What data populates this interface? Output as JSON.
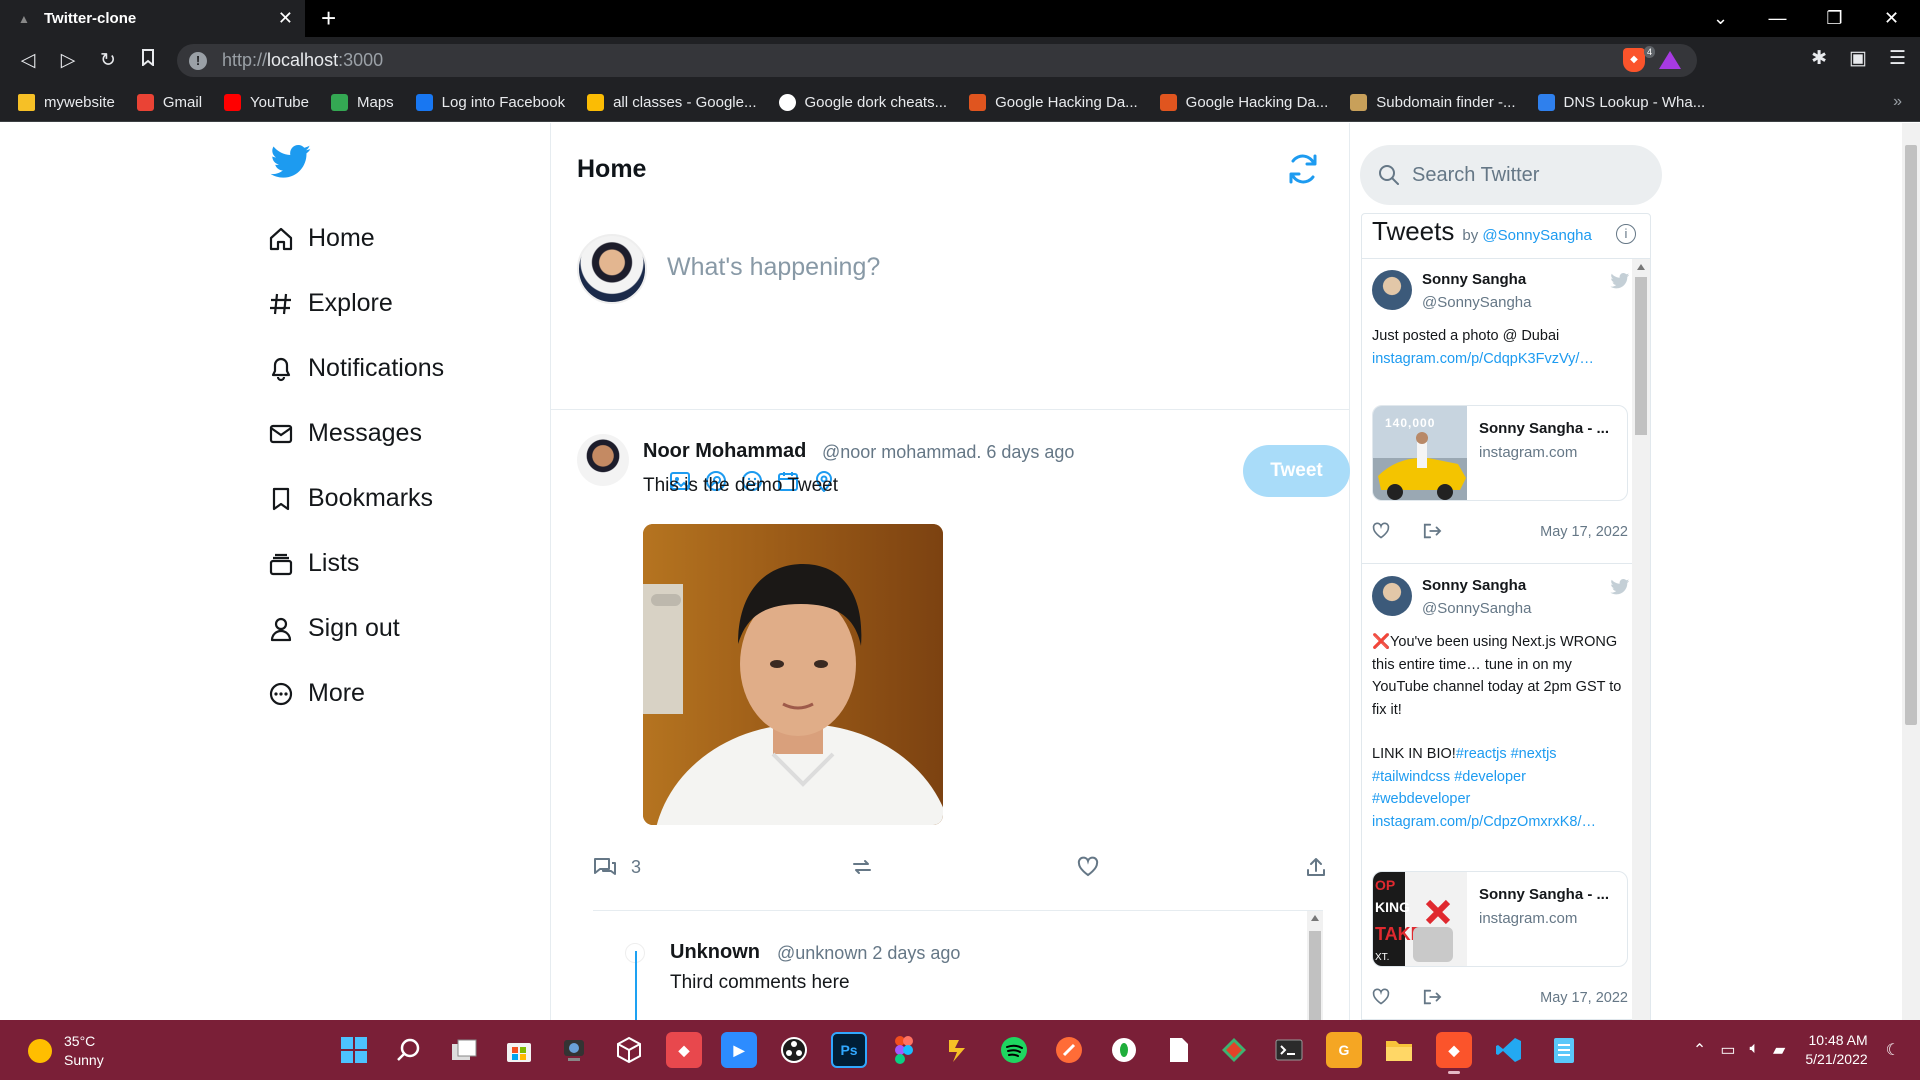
{
  "browser": {
    "tab_title": "Twitter-clone",
    "url_scheme": "http://",
    "url_host": "localhost",
    "url_port": ":3000",
    "shield_count": "4",
    "bookmarks": [
      {
        "label": "mywebsite",
        "icon": "folder-icon",
        "color": "#f6c026"
      },
      {
        "label": "Gmail",
        "icon": "gmail-icon",
        "color": "#ea4335"
      },
      {
        "label": "YouTube",
        "icon": "youtube-icon",
        "color": "#ff0000"
      },
      {
        "label": "Maps",
        "icon": "maps-icon",
        "color": "#34a853"
      },
      {
        "label": "Log into Facebook",
        "icon": "facebook-icon",
        "color": "#1877f2"
      },
      {
        "label": "all classes - Google...",
        "icon": "google-drive-icon",
        "color": "#fbbc04"
      },
      {
        "label": "Google dork cheats...",
        "icon": "github-icon",
        "color": "#ffffff"
      },
      {
        "label": "Google Hacking Da...",
        "icon": "exploit-db-icon",
        "color": "#e0551f"
      },
      {
        "label": "Google Hacking Da...",
        "icon": "exploit-db-icon",
        "color": "#e0551f"
      },
      {
        "label": "Subdomain finder -...",
        "icon": "subdomain-icon",
        "color": "#c8a05a"
      },
      {
        "label": "DNS Lookup - Wha...",
        "icon": "globe-icon",
        "color": "#2f80ed"
      }
    ]
  },
  "sidebar": {
    "items": [
      {
        "label": "Home",
        "icon": "home-icon"
      },
      {
        "label": "Explore",
        "icon": "hashtag-icon"
      },
      {
        "label": "Notifications",
        "icon": "bell-icon"
      },
      {
        "label": "Messages",
        "icon": "envelope-icon"
      },
      {
        "label": "Bookmarks",
        "icon": "bookmark-icon"
      },
      {
        "label": "Lists",
        "icon": "lists-icon"
      },
      {
        "label": "Sign out",
        "icon": "user-icon"
      },
      {
        "label": "More",
        "icon": "more-icon"
      }
    ]
  },
  "feed": {
    "title": "Home",
    "composer_placeholder": "What's happening?",
    "tweet_button": "Tweet",
    "post": {
      "name": "Noor Mohammad",
      "meta": "@noor mohammad. 6 days ago",
      "text": "This is the demo Tweet",
      "comment_count": "3"
    },
    "comment": {
      "name": "Unknown",
      "meta": "@unknown 2 days ago",
      "text": "Third comments here"
    }
  },
  "right": {
    "search_placeholder": "Search Twitter",
    "timeline_title": "Tweets",
    "timeline_by": "by",
    "timeline_handle": "@SonnySangha",
    "tweets": [
      {
        "name": "Sonny Sangha",
        "handle": "@SonnySangha",
        "text": "Just posted a photo @ Dubai",
        "link": "instagram.com/p/CdqpK3FvzVy/…",
        "card_title": "Sonny Sangha - ...",
        "card_site": "instagram.com",
        "card_badge": "140,000",
        "date": "May 17, 2022"
      },
      {
        "name": "Sonny Sangha",
        "handle": "@SonnySangha",
        "text_line1": "❌You've been using Next.js WRONG this entire time… tune in on my YouTube channel today at 2pm GST to fix it!",
        "text_line2": "LINK IN BIO!",
        "hashtags": "#reactjs #nextjs #tailwindcss #developer #webdeveloper",
        "link": "instagram.com/p/CdpzOmxrxK8/…",
        "card_title": "Sonny Sangha - ...",
        "card_site": "instagram.com",
        "date": "May 17, 2022"
      }
    ]
  },
  "taskbar": {
    "temp": "35°C",
    "condition": "Sunny",
    "time": "10:48 AM",
    "date": "5/21/2022"
  },
  "colors": {
    "twitter_blue": "#1d9bf0",
    "tweet_button_disabled": "#a9dcf9",
    "taskbar": "#7a1f37"
  }
}
